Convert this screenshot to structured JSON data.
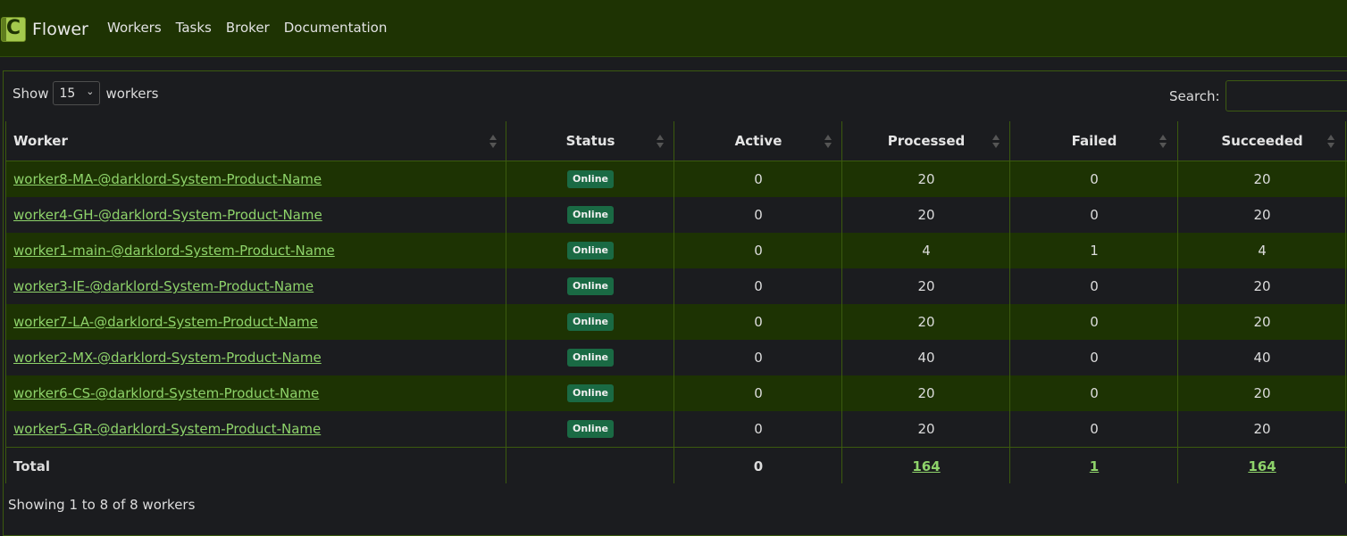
{
  "app": {
    "name": "Flower"
  },
  "nav": [
    "Workers",
    "Tasks",
    "Broker",
    "Documentation"
  ],
  "controls": {
    "show_label": "Show",
    "page_size": "15",
    "unit_label": "workers",
    "search_label": "Search:",
    "search_value": ""
  },
  "table": {
    "headers": [
      "Worker",
      "Status",
      "Active",
      "Processed",
      "Failed",
      "Succeeded"
    ],
    "rows": [
      {
        "worker": "worker8-MA-@darklord-System-Product-Name",
        "status": "Online",
        "active": "0",
        "processed": "20",
        "failed": "0",
        "succeeded": "20"
      },
      {
        "worker": "worker4-GH-@darklord-System-Product-Name",
        "status": "Online",
        "active": "0",
        "processed": "20",
        "failed": "0",
        "succeeded": "20"
      },
      {
        "worker": "worker1-main-@darklord-System-Product-Name",
        "status": "Online",
        "active": "0",
        "processed": "4",
        "failed": "1",
        "succeeded": "4"
      },
      {
        "worker": "worker3-IE-@darklord-System-Product-Name",
        "status": "Online",
        "active": "0",
        "processed": "20",
        "failed": "0",
        "succeeded": "20"
      },
      {
        "worker": "worker7-LA-@darklord-System-Product-Name",
        "status": "Online",
        "active": "0",
        "processed": "20",
        "failed": "0",
        "succeeded": "20"
      },
      {
        "worker": "worker2-MX-@darklord-System-Product-Name",
        "status": "Online",
        "active": "0",
        "processed": "40",
        "failed": "0",
        "succeeded": "40"
      },
      {
        "worker": "worker6-CS-@darklord-System-Product-Name",
        "status": "Online",
        "active": "0",
        "processed": "20",
        "failed": "0",
        "succeeded": "20"
      },
      {
        "worker": "worker5-GR-@darklord-System-Product-Name",
        "status": "Online",
        "active": "0",
        "processed": "20",
        "failed": "0",
        "succeeded": "20"
      }
    ],
    "total": {
      "label": "Total",
      "active": "0",
      "processed": "164",
      "failed": "1",
      "succeeded": "164"
    }
  },
  "footer": {
    "info": "Showing 1 to 8 of 8 workers"
  },
  "colors": {
    "navbar": "#1e3303",
    "row_highlight": "#1d3303",
    "link": "#8ed36a",
    "badge_online": "#1a6a44",
    "border": "#3b5a0e"
  }
}
